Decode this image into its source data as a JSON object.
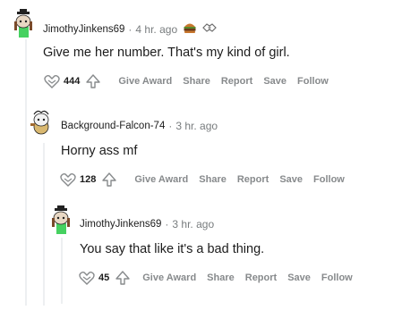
{
  "comments": [
    {
      "username": "JimothyJinkens69",
      "time": "4 hr. ago",
      "body": "Give me her number. That's my kind of girl.",
      "score": "444",
      "actions": [
        "Give Award",
        "Share",
        "Report",
        "Save",
        "Follow"
      ],
      "awards": [
        "burger-award-icon",
        "handshake-award-icon"
      ]
    },
    {
      "username": "Background-Falcon-74",
      "time": "3 hr. ago",
      "body": "Horny ass mf",
      "score": "128",
      "actions": [
        "Give Award",
        "Share",
        "Report",
        "Save",
        "Follow"
      ]
    },
    {
      "username": "JimothyJinkens69",
      "time": "3 hr. ago",
      "body": "You say that like it's a bad thing.",
      "score": "45",
      "actions": [
        "Give Award",
        "Share",
        "Report",
        "Save",
        "Follow"
      ]
    }
  ],
  "separator": "·",
  "colors": {
    "thread_line": "#edeff1",
    "meta_text": "#787c7e",
    "action_text": "#878a8c",
    "avatar_green": "#46d160"
  }
}
